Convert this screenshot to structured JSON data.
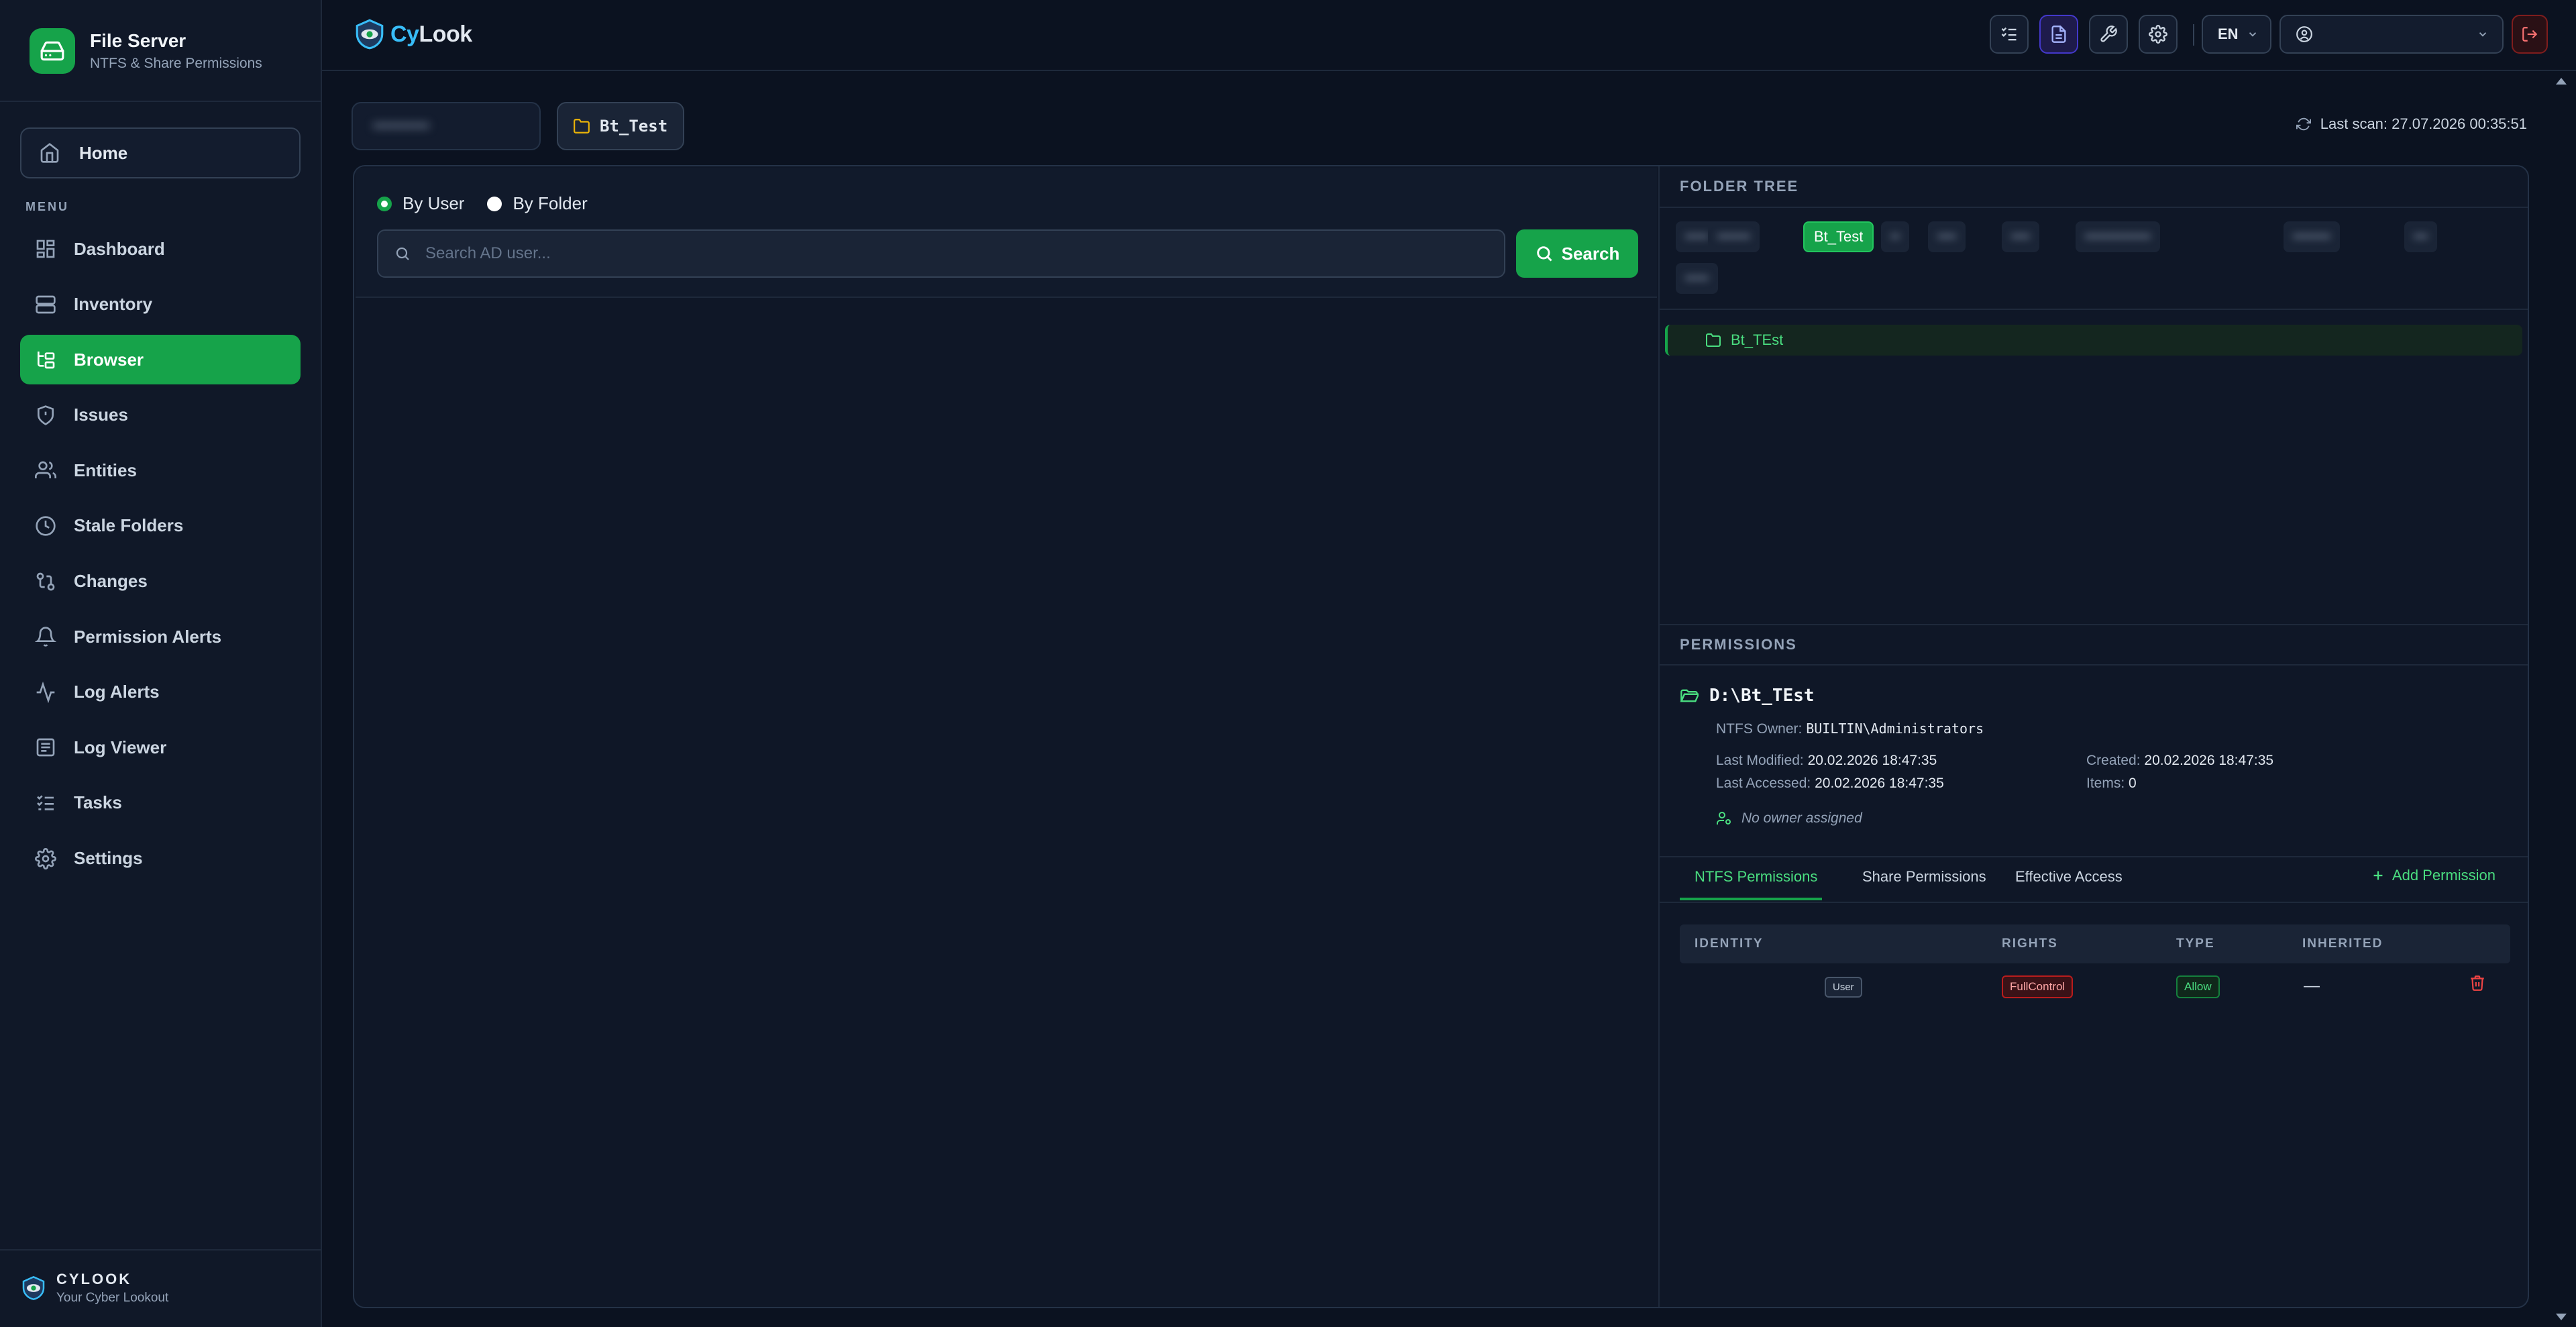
{
  "sidebar": {
    "app_title": "File Server",
    "app_subtitle": "NTFS & Share Permissions",
    "home_label": "Home",
    "menu_label": "MENU",
    "items": [
      {
        "label": "Dashboard",
        "icon": "dashboard-icon"
      },
      {
        "label": "Inventory",
        "icon": "server-icon"
      },
      {
        "label": "Browser",
        "icon": "folder-tree-icon",
        "active": true
      },
      {
        "label": "Issues",
        "icon": "shield-icon"
      },
      {
        "label": "Entities",
        "icon": "users-icon"
      },
      {
        "label": "Stale Folders",
        "icon": "clock-icon"
      },
      {
        "label": "Changes",
        "icon": "git-compare-icon"
      },
      {
        "label": "Permission Alerts",
        "icon": "bell-icon"
      },
      {
        "label": "Log Alerts",
        "icon": "activity-icon"
      },
      {
        "label": "Log Viewer",
        "icon": "log-viewer-icon"
      },
      {
        "label": "Tasks",
        "icon": "tasks-icon"
      },
      {
        "label": "Settings",
        "icon": "gear-icon"
      }
    ],
    "footer_name": "CYLOOK",
    "footer_tagline": "Your Cyber Lookout"
  },
  "topbar": {
    "logo_cy": "Cy",
    "logo_rest": "Look",
    "language": "EN",
    "buttons": [
      "tasks-icon",
      "report-icon",
      "tools-icon",
      "gear-icon"
    ]
  },
  "path": {
    "server_name": "••••••••••",
    "folder": "Bt_Test",
    "last_scan": "Last scan: 27.07.2026 00:35:51"
  },
  "search": {
    "mode_user": "By User",
    "mode_folder": "By Folder",
    "selected_mode": "By User",
    "placeholder": "Search AD user...",
    "button_label": "Search"
  },
  "folder_tree": {
    "header": "FOLDER TREE",
    "active_crumb": "Bt_Test",
    "blurred_crumbs": [
      "•••••",
      "•••••••",
      "••",
      "••••",
      "••••",
      "••••••••••••••",
      "••••••••",
      "•••",
      "•••••"
    ],
    "selected_node": "Bt_TEst"
  },
  "permissions": {
    "header": "PERMISSIONS",
    "path": "D:\\Bt_TEst",
    "owner_label": "NTFS Owner:",
    "owner_value": "BUILTIN\\Administrators",
    "last_modified_label": "Last Modified:",
    "last_modified": "20.02.2026 18:47:35",
    "last_accessed_label": "Last Accessed:",
    "last_accessed": "20.02.2026 18:47:35",
    "created_label": "Created:",
    "created": "20.02.2026 18:47:35",
    "items_label": "Items:",
    "items": "0",
    "no_owner": "No owner assigned",
    "tabs": [
      "NTFS Permissions",
      "Share Permissions",
      "Effective Access"
    ],
    "active_tab": "NTFS Permissions",
    "add_label": "Add Permission",
    "columns": [
      "IDENTITY",
      "RIGHTS",
      "TYPE",
      "INHERITED"
    ],
    "rows": [
      {
        "identity_type": "User",
        "rights": "FullControl",
        "type": "Allow",
        "inherited": "—"
      }
    ]
  },
  "colors": {
    "accent": "#16a34a",
    "accent_text": "#4ade80",
    "background": "#0b1220",
    "panel": "#0f1727",
    "danger": "#f87171"
  }
}
